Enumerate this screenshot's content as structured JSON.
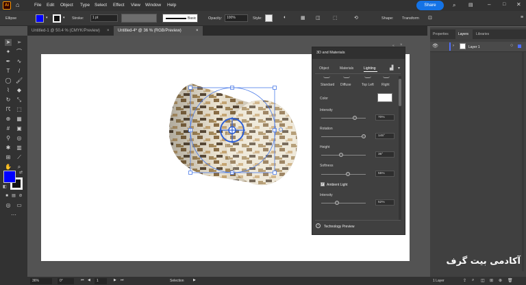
{
  "menubar": {
    "app_logo": "Ai",
    "items": [
      "File",
      "Edit",
      "Object",
      "Type",
      "Select",
      "Effect",
      "View",
      "Window",
      "Help"
    ],
    "share_label": "Share"
  },
  "control": {
    "object_type": "Ellipse",
    "stroke_label": "Stroke:",
    "stroke_value": "1 pt",
    "brush_label": "Basic",
    "opacity_label": "Opacity:",
    "opacity_value": "100%",
    "style_label": "Style:",
    "shape_label": "Shape:",
    "transform_label": "Transform"
  },
  "tabs": [
    {
      "label": "Untitled-1 @ 50.4 % (CMYK/Preview)",
      "active": false
    },
    {
      "label": "Untitled-4* @ 36 % (RGB/Preview)",
      "active": true
    }
  ],
  "panel3d": {
    "title": "3D and Materials",
    "tabs": [
      "Object",
      "Materials",
      "Lighting"
    ],
    "active_tab": "Lighting",
    "presets": [
      "Standard",
      "Diffuse",
      "Top Left",
      "Right"
    ],
    "color_label": "Color",
    "intensity_label": "Intensity",
    "intensity_value": "70%",
    "intensity_level": 0.7,
    "rotation_label": "Rotation",
    "rotation_value": "145°",
    "rotation_level": 0.9,
    "height_label": "Height",
    "height_value": "36°",
    "height_level": 0.4,
    "softness_label": "Softness",
    "softness_value": "55%",
    "softness_level": 0.55,
    "ambient_label": "Ambient Light",
    "ambient_intensity_label": "Intensity",
    "ambient_intensity_value": "52%",
    "ambient_intensity_level": 0.3,
    "footer_label": "Technology Preview"
  },
  "layers_panel": {
    "tabs": [
      "Properties",
      "Layers",
      "Libraries"
    ],
    "active_tab": "Layers",
    "layer_name": "Layer 1",
    "footer_count": "1 Layer"
  },
  "status": {
    "zoom": "36%",
    "rotate": "0°",
    "page": "1",
    "tool": "Selection"
  },
  "watermark": "آکادمی بیت گرف"
}
